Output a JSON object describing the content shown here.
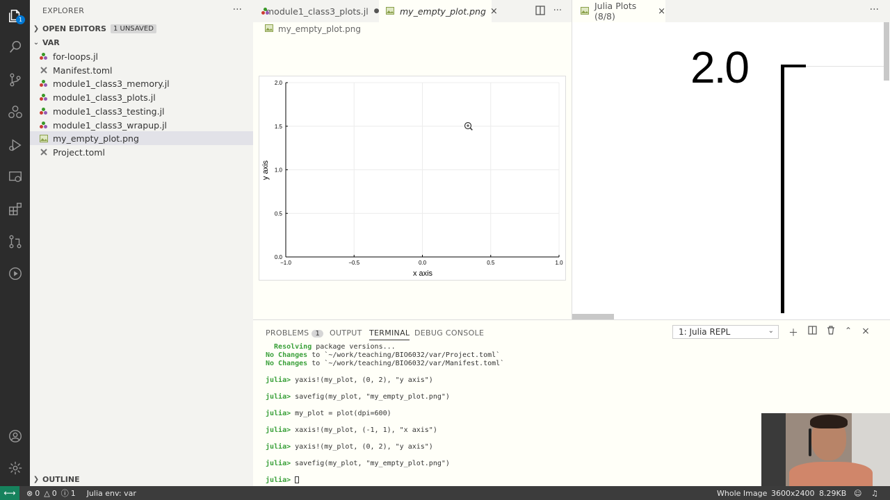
{
  "sidebar": {
    "title": "EXPLORER",
    "open_editors": {
      "label": "OPEN EDITORS",
      "badge": "1 UNSAVED"
    },
    "folder": "VAR",
    "outline": "OUTLINE",
    "files": [
      {
        "name": "for-loops.jl"
      },
      {
        "name": "Manifest.toml"
      },
      {
        "name": "module1_class3_memory.jl"
      },
      {
        "name": "module1_class3_plots.jl"
      },
      {
        "name": "module1_class3_testing.jl"
      },
      {
        "name": "module1_class3_wrapup.jl"
      },
      {
        "name": "my_empty_plot.png"
      },
      {
        "name": "Project.toml"
      }
    ]
  },
  "activity": {
    "explorer_badge": "1"
  },
  "editor": {
    "tabs": [
      {
        "label": "module1_class3_plots.jl"
      },
      {
        "label": "my_empty_plot.png"
      }
    ],
    "breadcrumb": "my_empty_plot.png"
  },
  "plot": {
    "x_ticks": [
      "−1.0",
      "−0.5",
      "0.0",
      "0.5",
      "1.0"
    ],
    "y_ticks": [
      "0.0",
      "0.5",
      "1.0",
      "1.5",
      "2.0"
    ],
    "xlabel": "x axis",
    "ylabel": "y axis"
  },
  "chart_data": {
    "type": "line",
    "series": [],
    "xlabel": "x axis",
    "ylabel": "y axis",
    "xlim": [
      -1,
      1
    ],
    "ylim": [
      0,
      2
    ],
    "grid": true
  },
  "right_pane": {
    "tab_label": "Julia Plots (8/8)",
    "zoomed_tick": "2.0"
  },
  "panel": {
    "tabs": {
      "problems": "PROBLEMS",
      "problems_count": "1",
      "output": "OUTPUT",
      "terminal": "TERMINAL",
      "debug": "DEBUG CONSOLE"
    },
    "terminal_select": "1: Julia REPL",
    "lines": [
      {
        "g": "  Resolving",
        "t": " package versions..."
      },
      {
        "g": "No Changes",
        "t": " to `~/work/teaching/BIO6032/var/Project.toml`"
      },
      {
        "g": "No Changes",
        "t": " to `~/work/teaching/BIO6032/var/Manifest.toml`"
      },
      {
        "g": "",
        "t": ""
      },
      {
        "g": "julia>",
        "t": " yaxis!(my_plot, (0, 2), \"y axis\")"
      },
      {
        "g": "",
        "t": ""
      },
      {
        "g": "julia>",
        "t": " savefig(my_plot, \"my_empty_plot.png\")"
      },
      {
        "g": "",
        "t": ""
      },
      {
        "g": "julia>",
        "t": " my_plot = plot(dpi=600)"
      },
      {
        "g": "",
        "t": ""
      },
      {
        "g": "julia>",
        "t": " xaxis!(my_plot, (-1, 1), \"x axis\")"
      },
      {
        "g": "",
        "t": ""
      },
      {
        "g": "julia>",
        "t": " yaxis!(my_plot, (0, 2), \"y axis\")"
      },
      {
        "g": "",
        "t": ""
      },
      {
        "g": "julia>",
        "t": " savefig(my_plot, \"my_empty_plot.png\")"
      },
      {
        "g": "",
        "t": ""
      },
      {
        "g": "julia>",
        "t": " "
      }
    ]
  },
  "status": {
    "errors": "0",
    "warnings": "0",
    "info": "1",
    "julia_env": "Julia env: var",
    "whole_image": "Whole Image",
    "dimensions": "3600x2400",
    "size": "8.29KB"
  }
}
